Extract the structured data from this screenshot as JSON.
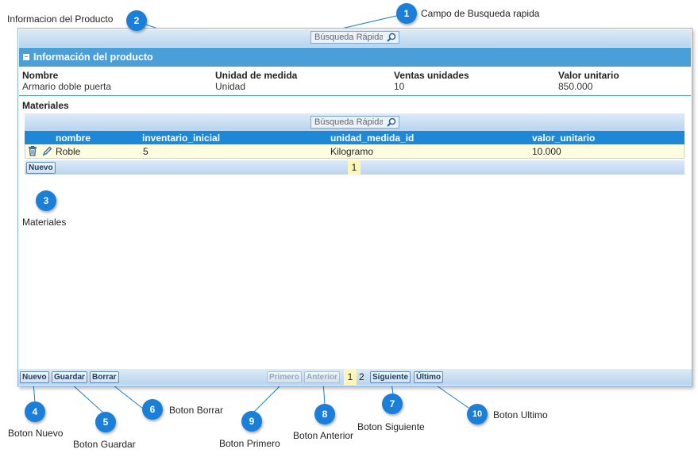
{
  "annotations": {
    "c1": {
      "num": "1",
      "text": "Campo de Busqueda rapida"
    },
    "c2": {
      "num": "2",
      "text": "Informacion del Producto"
    },
    "c3": {
      "num": "3",
      "text": "Materiales"
    },
    "c4": {
      "num": "4",
      "text": "Boton Nuevo"
    },
    "c5": {
      "num": "5",
      "text": "Boton Guardar"
    },
    "c6": {
      "num": "6",
      "text": "Boton Borrar"
    },
    "c7": {
      "num": "7",
      "text": "Boton Siguiente"
    },
    "c8": {
      "num": "8",
      "text": "Boton Anterior"
    },
    "c9": {
      "num": "9",
      "text": "Boton Primero"
    },
    "c10": {
      "num": "10",
      "text": "Boton Ultimo"
    }
  },
  "top_search": {
    "placeholder": "Búsqueda Rápida"
  },
  "product": {
    "section_title": "Información del producto",
    "fields": [
      {
        "label": "Nombre",
        "value": "Armario doble puerta"
      },
      {
        "label": "Unidad de medida",
        "value": "Unidad"
      },
      {
        "label": "Ventas unidades",
        "value": "10"
      },
      {
        "label": "Valor unitario",
        "value": "850.000"
      }
    ]
  },
  "materials": {
    "title": "Materiales",
    "search_placeholder": "Búsqueda Rápida",
    "columns": [
      "nombre",
      "inventario_inicial",
      "unidad_medida_id",
      "valor_unitario"
    ],
    "rows": [
      {
        "nombre": "Roble",
        "inventario_inicial": "5",
        "unidad_medida_id": "Kilogramo",
        "valor_unitario": "10.000"
      }
    ],
    "new_button": "Nuevo",
    "current_page": "1"
  },
  "footer": {
    "new": "Nuevo",
    "save": "Guardar",
    "delete": "Borrar",
    "first": "Primero",
    "prev": "Anterior",
    "current_page": "1",
    "next_page": "2",
    "next": "Siguiente",
    "last": "Último"
  },
  "colors": {
    "accent": "#1a7fd9",
    "section_header": "#4a9fd8",
    "grid_header": "#1e87d6",
    "selected_row": "#fffde0"
  }
}
